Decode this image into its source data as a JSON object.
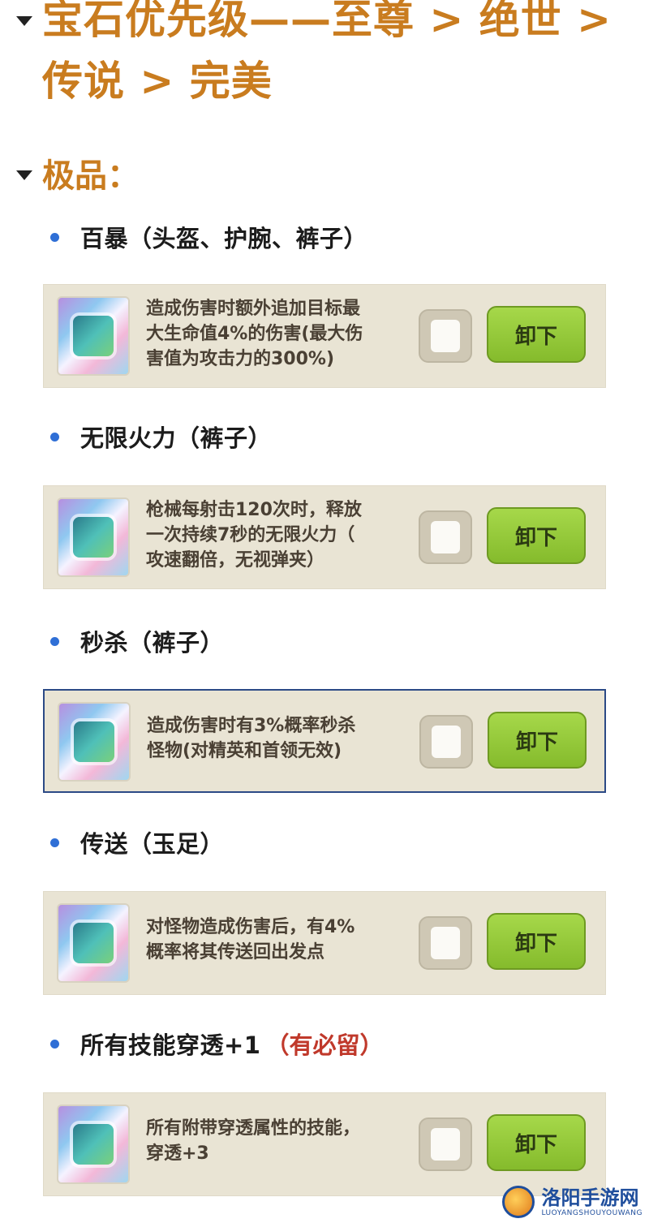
{
  "title_lines": [
    "宝石优先级——至尊 > 绝世 >",
    "传说 > 完美"
  ],
  "section": {
    "label": "极品："
  },
  "items": [
    {
      "label": "百暴（头盔、护腕、裤子）",
      "extra": "",
      "description": [
        "造成伤害时额外追加目标最",
        "大生命值4%的伤害(最大伤",
        "害值为攻击力的300%)"
      ],
      "button": "卸下"
    },
    {
      "label": "无限火力（裤子）",
      "extra": "",
      "description": [
        "枪械每射击120次时，释放",
        "一次持续7秒的无限火力（",
        "攻速翻倍，无视弹夹）"
      ],
      "button": "卸下"
    },
    {
      "label": "秒杀（裤子）",
      "extra": "",
      "description": [
        "造成伤害时有3%概率秒杀",
        "怪物(对精英和首领无效)"
      ],
      "button": "卸下"
    },
    {
      "label": "传送（玉足）",
      "extra": "",
      "description": [
        "对怪物造成伤害后，有4%",
        "概率将其传送回出发点"
      ],
      "button": "卸下"
    },
    {
      "label": "所有技能穿透+1",
      "extra": "（有必留）",
      "description": [
        "所有附带穿透属性的技能，",
        "穿透+3"
      ],
      "button": "卸下"
    }
  ],
  "watermark": {
    "main": "洛阳手游网",
    "sub": "LUOYANGSHOUYOUWANG"
  },
  "colors": {
    "heading": "#c97c1f",
    "bullet": "#2f6fd6",
    "highlight": "#c0392b",
    "button_green": "#95c93a"
  }
}
